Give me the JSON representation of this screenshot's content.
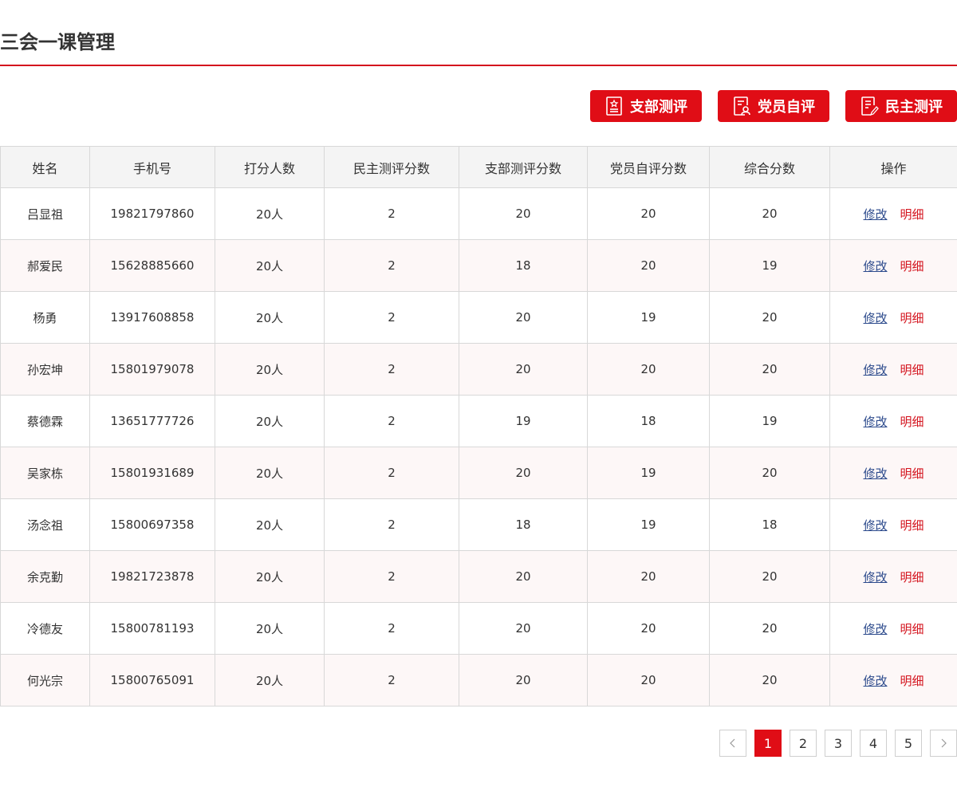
{
  "header": {
    "title": "三会一课管理"
  },
  "actions": [
    {
      "label": "支部测评",
      "icon": "branch-evaluation-icon"
    },
    {
      "label": "党员自评",
      "icon": "member-self-evaluation-icon"
    },
    {
      "label": "民主测评",
      "icon": "democratic-evaluation-icon"
    }
  ],
  "table": {
    "columns": [
      "姓名",
      "手机号",
      "打分人数",
      "民主测评分数",
      "支部测评分数",
      "党员自评分数",
      "综合分数",
      "操作"
    ],
    "edit_label": "修改",
    "detail_label": "明细",
    "rows": [
      {
        "name": "吕显祖",
        "phone": "19821797860",
        "raters": "20人",
        "democratic": "2",
        "branch": "20",
        "self": "20",
        "total": "20"
      },
      {
        "name": "郝爱民",
        "phone": "15628885660",
        "raters": "20人",
        "democratic": "2",
        "branch": "18",
        "self": "20",
        "total": "19"
      },
      {
        "name": "杨勇",
        "phone": "13917608858",
        "raters": "20人",
        "democratic": "2",
        "branch": "20",
        "self": "19",
        "total": "20"
      },
      {
        "name": "孙宏坤",
        "phone": "15801979078",
        "raters": "20人",
        "democratic": "2",
        "branch": "20",
        "self": "20",
        "total": "20"
      },
      {
        "name": "蔡德霖",
        "phone": "13651777726",
        "raters": "20人",
        "democratic": "2",
        "branch": "19",
        "self": "18",
        "total": "19"
      },
      {
        "name": "吴家栋",
        "phone": "15801931689",
        "raters": "20人",
        "democratic": "2",
        "branch": "20",
        "self": "19",
        "total": "20"
      },
      {
        "name": "汤念祖",
        "phone": "15800697358",
        "raters": "20人",
        "democratic": "2",
        "branch": "18",
        "self": "19",
        "total": "18"
      },
      {
        "name": "余克勤",
        "phone": "19821723878",
        "raters": "20人",
        "democratic": "2",
        "branch": "20",
        "self": "20",
        "total": "20"
      },
      {
        "name": "冷德友",
        "phone": "15800781193",
        "raters": "20人",
        "democratic": "2",
        "branch": "20",
        "self": "20",
        "total": "20"
      },
      {
        "name": "何光宗",
        "phone": "15800765091",
        "raters": "20人",
        "democratic": "2",
        "branch": "20",
        "self": "20",
        "total": "20"
      }
    ]
  },
  "pagination": {
    "pages": [
      "1",
      "2",
      "3",
      "4",
      "5"
    ],
    "current": "1",
    "prev_icon": "chevron-left-icon",
    "next_icon": "chevron-right-icon"
  },
  "colors": {
    "primary": "#e00d16",
    "link": "#2c4a8c",
    "row_alt": "#fdf7f7",
    "header_bg": "#f4f4f4"
  }
}
